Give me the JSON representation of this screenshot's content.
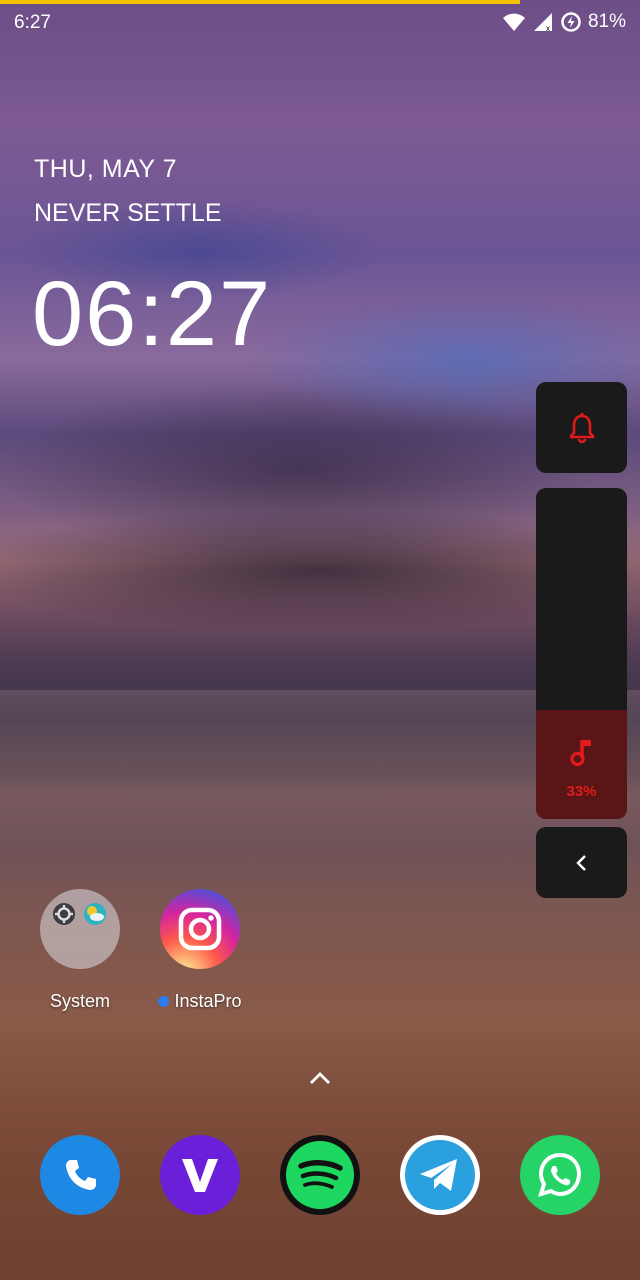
{
  "status_bar": {
    "time": "6:27",
    "battery": "81%",
    "icons": [
      "wifi-icon",
      "signal-icon",
      "battery-saver-icon"
    ]
  },
  "lockscreen": {
    "date": "THU, MAY 7",
    "tagline": "NEVER SETTLE",
    "clock": "06:27"
  },
  "volume_panel": {
    "ring_icon": "bell-icon",
    "media_icon": "music-note-icon",
    "level_label": "33%",
    "level": 0.33,
    "collapse_icon": "chevron-left-icon",
    "accent_color": "#e11a1a"
  },
  "apps": [
    {
      "label": "System",
      "icon": "folder-icon"
    },
    {
      "label": "InstaPro",
      "icon": "instagram-icon",
      "new_indicator": true
    }
  ],
  "dock": [
    {
      "name": "Phone",
      "icon": "phone-icon",
      "color": "#1e88e5"
    },
    {
      "name": "Viper",
      "icon": "v-icon",
      "color": "#6a1fd8"
    },
    {
      "name": "Spotify",
      "icon": "spotify-icon",
      "color": "#1ed760"
    },
    {
      "name": "Telegram",
      "icon": "telegram-icon",
      "color": "#2aa1de"
    },
    {
      "name": "WhatsApp",
      "icon": "whatsapp-icon",
      "color": "#25d366"
    }
  ]
}
